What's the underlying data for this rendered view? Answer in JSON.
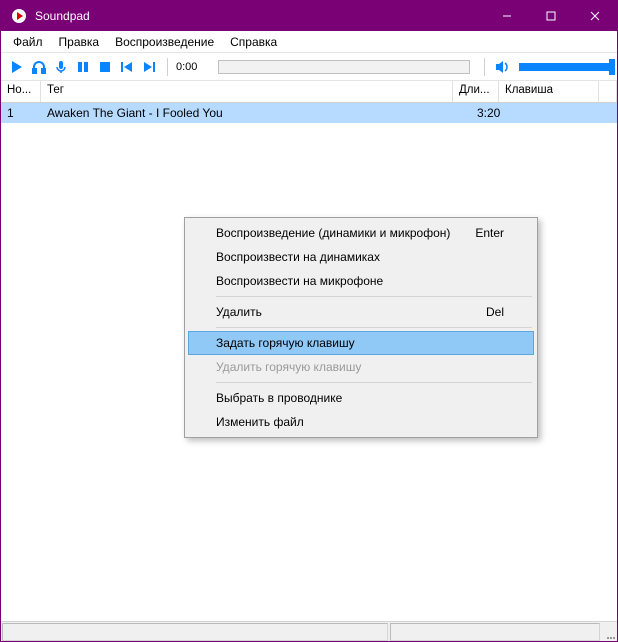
{
  "titlebar": {
    "title": "Soundpad"
  },
  "menubar": [
    "Файл",
    "Правка",
    "Воспроизведение",
    "Справка"
  ],
  "toolbar": {
    "time": "0:00"
  },
  "table": {
    "headers": {
      "num": "Но...",
      "tag": "Тег",
      "dur": "Дли...",
      "key": "Клавиша"
    },
    "rows": [
      {
        "num": "1",
        "tag": "Awaken The Giant - I Fooled You",
        "dur": "3:20",
        "key": ""
      }
    ]
  },
  "contextMenu": {
    "items": [
      {
        "label": "Воспроизведение (динамики и микрофон)",
        "shortcut": "Enter",
        "state": "normal"
      },
      {
        "label": "Воспроизвести на динамиках",
        "shortcut": "",
        "state": "normal"
      },
      {
        "label": "Воспроизвести на микрофоне",
        "shortcut": "",
        "state": "normal"
      },
      {
        "sep": true
      },
      {
        "label": "Удалить",
        "shortcut": "Del",
        "state": "normal"
      },
      {
        "sep": true
      },
      {
        "label": "Задать горячую клавишу",
        "shortcut": "",
        "state": "hot"
      },
      {
        "label": "Удалить горячую клавишу",
        "shortcut": "",
        "state": "disabled"
      },
      {
        "sep": true
      },
      {
        "label": "Выбрать в проводнике",
        "shortcut": "",
        "state": "normal"
      },
      {
        "label": "Изменить файл",
        "shortcut": "",
        "state": "normal"
      }
    ]
  }
}
